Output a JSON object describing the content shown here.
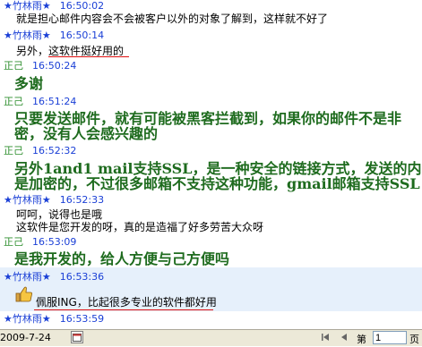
{
  "messages": [
    {
      "sender": "★竹林雨★",
      "time": "16:50:02",
      "text": "就是担心邮件内容会不会被客户以外的对象了解到，这样就不好了"
    },
    {
      "sender": "★竹林雨★",
      "time": "16:50:14",
      "text": "另外，这软件挺好用的"
    },
    {
      "sender": "正己",
      "time": "16:50:24",
      "text": "多谢"
    },
    {
      "sender": "正己",
      "time": "16:51:24",
      "line1": "只要发送邮件，就有可能被黑客拦截到，如果你的邮件不是非",
      "line2": "密，没有人会感兴趣的"
    },
    {
      "sender": "正己",
      "time": "16:52:32",
      "line1": "另外1and1 mail支持SSL，是一种安全的链接方式，发送的内",
      "line2": "是加密的，不过很多邮箱不支持这种功能，gmail邮箱支持SSL"
    },
    {
      "sender": "★竹林雨★",
      "time": "16:52:33",
      "line1": "呵呵，说得也是哦",
      "line2": "这软件是您开发的呀，真的是造福了好多劳苦大众呀"
    },
    {
      "sender": "正己",
      "time": "16:53:09",
      "text": "是我开发的，给人方便与己方便吗"
    },
    {
      "sender": "★竹林雨★",
      "time": "16:53:36",
      "text": "佩服ING，比起很多专业的软件都好用"
    },
    {
      "sender": "★竹林雨★",
      "time": "16:53:59"
    }
  ],
  "icons": {
    "thumb": "thumbs-up-icon"
  },
  "statusbar": {
    "date": "2009-7-24",
    "page_prefix": "第",
    "page_value": "1",
    "page_suffix": "页"
  }
}
